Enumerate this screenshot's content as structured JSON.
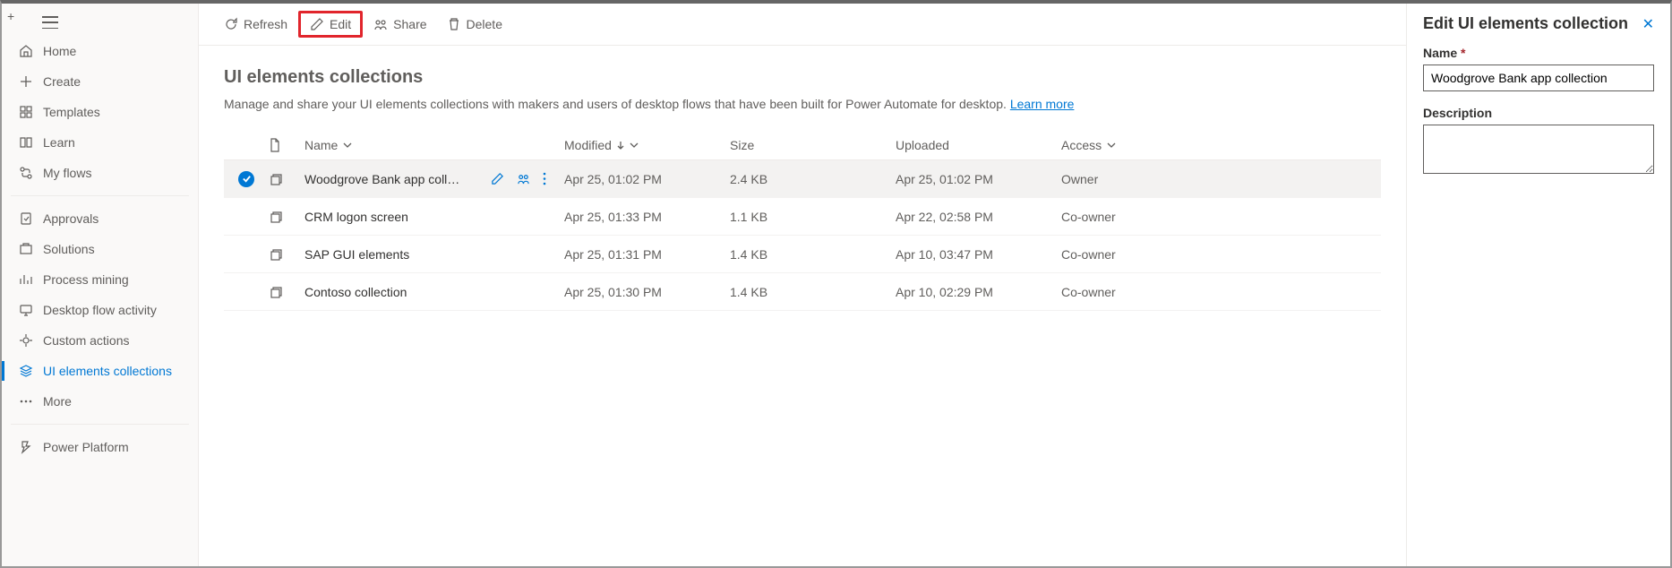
{
  "sidebar": {
    "items": [
      {
        "label": "Home",
        "icon": "home-icon"
      },
      {
        "label": "Create",
        "icon": "plus-icon"
      },
      {
        "label": "Templates",
        "icon": "templates-icon"
      },
      {
        "label": "Learn",
        "icon": "book-icon"
      },
      {
        "label": "My flows",
        "icon": "flows-icon"
      },
      {
        "label": "Approvals",
        "icon": "approvals-icon"
      },
      {
        "label": "Solutions",
        "icon": "solutions-icon"
      },
      {
        "label": "Process mining",
        "icon": "process-mining-icon"
      },
      {
        "label": "Desktop flow activity",
        "icon": "activity-icon"
      },
      {
        "label": "Custom actions",
        "icon": "custom-actions-icon"
      },
      {
        "label": "UI elements collections",
        "icon": "collections-icon"
      },
      {
        "label": "More",
        "icon": "more-icon"
      },
      {
        "label": "Power Platform",
        "icon": "power-platform-icon"
      }
    ]
  },
  "toolbar": {
    "refresh": "Refresh",
    "edit": "Edit",
    "share": "Share",
    "delete": "Delete"
  },
  "page": {
    "title": "UI elements collections",
    "description": "Manage and share your UI elements collections with makers and users of desktop flows that have been built for Power Automate for desktop.",
    "learn_more": "Learn more"
  },
  "table": {
    "headers": {
      "name": "Name",
      "modified": "Modified",
      "size": "Size",
      "uploaded": "Uploaded",
      "access": "Access"
    },
    "rows": [
      {
        "name": "Woodgrove Bank app coll…",
        "modified": "Apr 25, 01:02 PM",
        "size": "2.4 KB",
        "uploaded": "Apr 25, 01:02 PM",
        "access": "Owner",
        "selected": true
      },
      {
        "name": "CRM logon screen",
        "modified": "Apr 25, 01:33 PM",
        "size": "1.1 KB",
        "uploaded": "Apr 22, 02:58 PM",
        "access": "Co-owner",
        "selected": false
      },
      {
        "name": "SAP GUI elements",
        "modified": "Apr 25, 01:31 PM",
        "size": "1.4 KB",
        "uploaded": "Apr 10, 03:47 PM",
        "access": "Co-owner",
        "selected": false
      },
      {
        "name": "Contoso collection",
        "modified": "Apr 25, 01:30 PM",
        "size": "1.4 KB",
        "uploaded": "Apr 10, 02:29 PM",
        "access": "Co-owner",
        "selected": false
      }
    ]
  },
  "panel": {
    "title": "Edit UI elements collection",
    "name_label": "Name",
    "name_value": "Woodgrove Bank app collection",
    "description_label": "Description",
    "description_value": ""
  }
}
